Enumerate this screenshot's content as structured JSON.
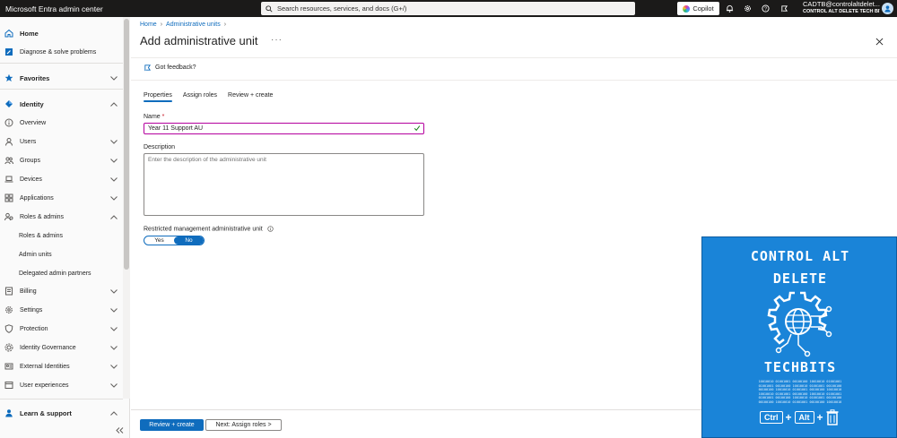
{
  "topbar": {
    "app_title": "Microsoft Entra admin center",
    "search_placeholder": "Search resources, services, and docs (G+/)",
    "copilot_label": "Copilot",
    "account_email": "CADTB@controlaltdelet...",
    "account_tenant": "CONTROL ALT DELETE TECH BITS..."
  },
  "sidebar": {
    "items": [
      {
        "label": "Home",
        "icon": "home-icon"
      },
      {
        "label": "Diagnose & solve problems",
        "icon": "wrench-icon"
      },
      {
        "label": "Favorites",
        "icon": "star-icon"
      },
      {
        "label": "Identity",
        "icon": "diamond-icon"
      },
      {
        "label": "Overview",
        "icon": "info-icon"
      },
      {
        "label": "Users",
        "icon": "person-icon"
      },
      {
        "label": "Groups",
        "icon": "people-icon"
      },
      {
        "label": "Devices",
        "icon": "laptop-icon"
      },
      {
        "label": "Applications",
        "icon": "grid-icon"
      },
      {
        "label": "Roles & admins",
        "icon": "roles-icon"
      },
      {
        "label": "Roles & admins"
      },
      {
        "label": "Admin units"
      },
      {
        "label": "Delegated admin partners"
      },
      {
        "label": "Billing",
        "icon": "billing-icon"
      },
      {
        "label": "Settings",
        "icon": "gear-icon"
      },
      {
        "label": "Protection",
        "icon": "shield-icon"
      },
      {
        "label": "Identity Governance",
        "icon": "governance-icon"
      },
      {
        "label": "External Identities",
        "icon": "external-icon"
      },
      {
        "label": "User experiences",
        "icon": "experience-icon"
      },
      {
        "label": "Learn & support",
        "icon": "person-support-icon"
      }
    ]
  },
  "breadcrumb": {
    "home": "Home",
    "admin_units": "Administrative units"
  },
  "page": {
    "title": "Add administrative unit",
    "more": "···",
    "feedback": "Got feedback?"
  },
  "tabs": [
    "Properties",
    "Assign roles",
    "Review + create"
  ],
  "form": {
    "name_label": "Name",
    "name_required": "*",
    "name_value": "Year 11 Support AU",
    "description_label": "Description",
    "description_placeholder": "Enter the description of the administrative unit",
    "restricted_label": "Restricted management administrative unit",
    "toggle_yes": "Yes",
    "toggle_no": "No"
  },
  "footer": {
    "primary": "Review + create",
    "secondary": "Next: Assign roles >"
  },
  "logo": {
    "line1": "CONTROL ALT",
    "line2": "DELETE",
    "line3": "TECHBITS",
    "key_ctrl": "Ctrl",
    "key_alt": "Alt",
    "plus": "+"
  },
  "colors": {
    "accent": "#0f6cbd",
    "topbar": "#1b1a19",
    "focus_border": "#b4009e",
    "logo_bg": "#1a84d8"
  }
}
